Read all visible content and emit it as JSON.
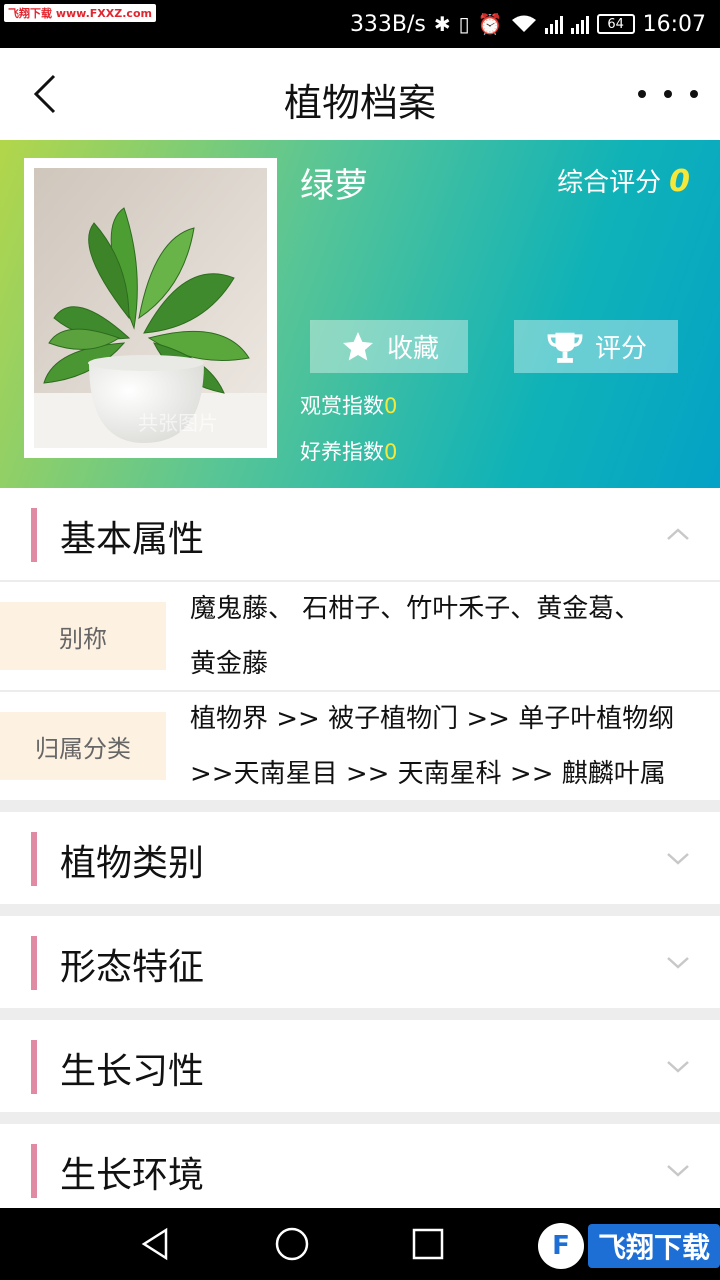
{
  "status_bar": {
    "watermark": "飞翔下载 www.FXXZ.com",
    "net_speed": "333B/s",
    "bluetooth_icon": "bluetooth-icon",
    "battery": "64",
    "time": "16:07"
  },
  "header": {
    "title": "植物档案"
  },
  "hero": {
    "plant_name": "绿萝",
    "rating_label": "综合评分",
    "rating_value": "0",
    "favorite_label": "收藏",
    "rate_label": "评分",
    "ornamental_label": "观赏指数",
    "ornamental_value": "0",
    "care_label": "好养指数",
    "care_value": "0",
    "accent_color": "#f5e83a"
  },
  "sections": {
    "basic": {
      "title": "基本属性",
      "expanded": true,
      "alias_label": "别称",
      "alias_line1": "魔鬼藤、 石柑子、竹叶禾子、黄金葛、",
      "alias_line2": "黄金藤",
      "taxonomy_label": "归属分类",
      "taxonomy_line1": "植物界 >> 被子植物门 >> 单子叶植物纲",
      "taxonomy_line2": ">>天南星目 >> 天南星科 >> 麒麟叶属"
    },
    "category": {
      "title": "植物类别"
    },
    "morphology": {
      "title": "形态特征"
    },
    "habit": {
      "title": "生长习性"
    },
    "environment": {
      "title": "生长环境"
    }
  },
  "navbar": {
    "watermark_logo": "飞翔下载"
  }
}
